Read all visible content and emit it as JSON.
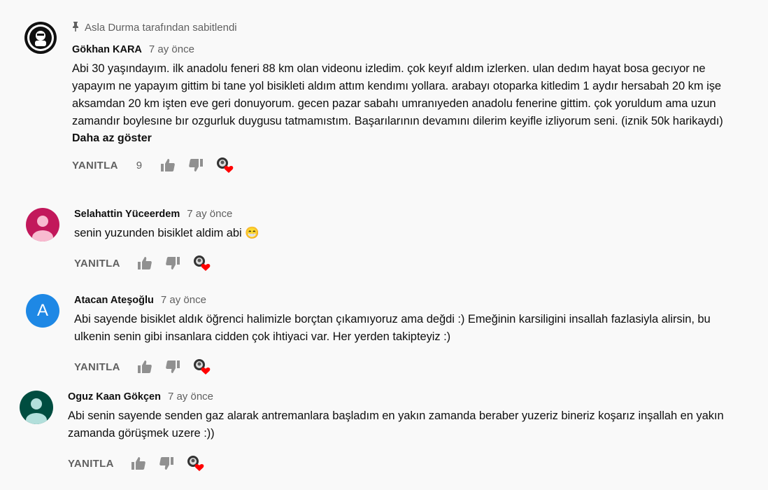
{
  "comments": [
    {
      "pinned_text": "Asla Durma tarafından sabitlendi",
      "author": "Gökhan KARA",
      "time": "7 ay önce",
      "text": "Abi 30 yaşındayım. ilk anadolu feneri 88 km olan videonu izledim. çok keyıf aldım izlerken. ulan dedım hayat bosa gecıyor ne yapayım ne yapayım gittim bi tane yol bisikleti aldım attım kendımı yollara. arabayı otoparka kitledim 1 aydır hersabah 20 km işe aksamdan 20 km işten eve geri donuyorum. gecen pazar sabahı umranıyeden anadolu fenerine gittim. çok yoruldum ama uzun zamandır boylesıne bır ozgurluk duygusu tatmamıstım. Başarılarının devamını dilerim keyifle izliyorum seni. (iznik 50k harikaydı)",
      "show_less": "Daha az göster",
      "reply": "YANITLA",
      "likes": "9"
    },
    {
      "author": "Selahattin Yüceerdem",
      "time": "7 ay önce",
      "text": "senin yuzunden bisiklet aldim abi 😁",
      "reply": "YANITLA",
      "avatar_color": "#c2185b"
    },
    {
      "author": "Atacan Ateşoğlu",
      "time": "7 ay önce",
      "text": "Abi sayende bisiklet aldık öğrenci halimizle borçtan çıkamıyoruz ama değdi :) Emeğinin karsiligini insallah fazlasiyla alirsin, bu ulkenin senin gibi insanlara cidden çok ihtiyaci var. Her yerden takipteyiz :)",
      "reply": "YANITLA",
      "avatar_letter": "A",
      "avatar_color": "#1e88e5"
    },
    {
      "author": "Oguz Kaan Gökçen",
      "time": "7 ay önce",
      "text": "Abi senin sayende senden gaz alarak antremanlara başladım en yakın zamanda beraber yuzeriz bineriz koşarız inşallah en yakın zamanda görüşmek uzere :))",
      "reply": "YANITLA",
      "avatar_color": "#004d40"
    }
  ],
  "colors": {
    "secondary_text": "#606060",
    "heart": "#ff0000"
  }
}
